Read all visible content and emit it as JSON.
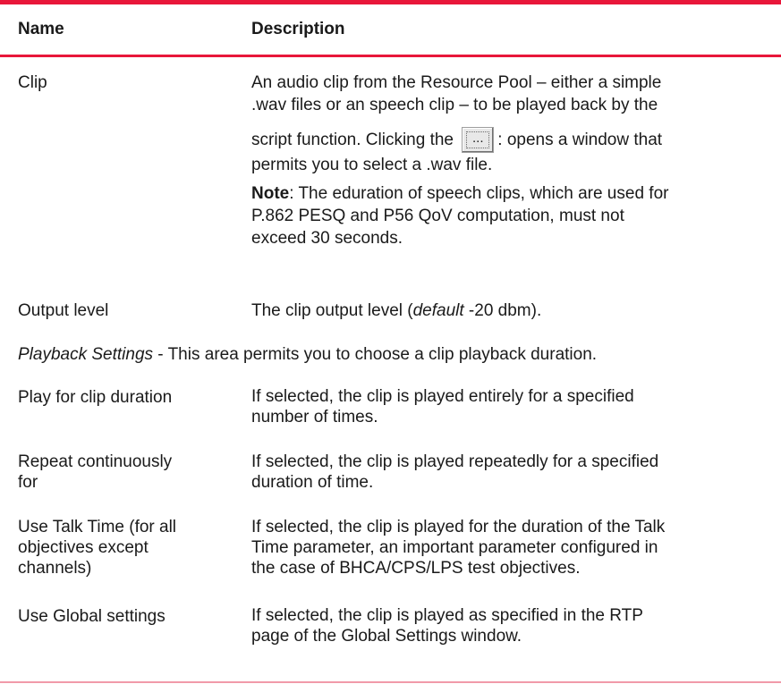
{
  "table": {
    "header": {
      "name": "Name",
      "description": "Description"
    },
    "clip": {
      "name": "Clip",
      "desc_line1": "An audio clip from the Resource Pool – either a simple",
      "desc_line2": ".wav files or an speech clip – to be played back by the",
      "desc_line3_pre": "script function. Clicking the",
      "button_glyph": "...",
      "desc_line3_post": ":  opens a window that",
      "desc_line4": "permits you to select a .wav file.",
      "note_label": "Note",
      "note_line1": ": The eduration of speech clips, which are used for",
      "note_line2": "P.862 PESQ and P56 QoV computation, must not",
      "note_line3": "exceed 30 seconds."
    },
    "output_level": {
      "name": "Output level",
      "desc_pre": "The clip output level (",
      "desc_em": "default",
      "desc_post": " -20 dbm)."
    },
    "playback_settings": {
      "label": "Playback Settings",
      "text": " - This area permits you to choose a clip playback duration."
    },
    "play_for_clip": {
      "name": "Play for clip duration",
      "desc_line1": "If selected, the clip is played entirely for a specified",
      "desc_line2": "number of times."
    },
    "repeat": {
      "name_line1": "Repeat continuously",
      "name_line2": "for",
      "desc_line1": "If selected, the clip is played repeatedly for a specified",
      "desc_line2": "duration of time."
    },
    "talk_time": {
      "name_line1": "Use Talk Time (for all",
      "name_line2": "objectives except",
      "name_line3": "channels)",
      "desc_line1": "If selected, the clip is played for the duration of the Talk",
      "desc_line2": "Time parameter, an important parameter configured in",
      "desc_line3": "the case of BHCA/CPS/LPS test objectives."
    },
    "global": {
      "name": "Use Global settings",
      "desc_line1": "If selected, the clip is played as specified in the RTP",
      "desc_line2": "page of the Global Settings window."
    }
  },
  "colors": {
    "rule": "#e8173a",
    "text": "#1a1a1a"
  }
}
